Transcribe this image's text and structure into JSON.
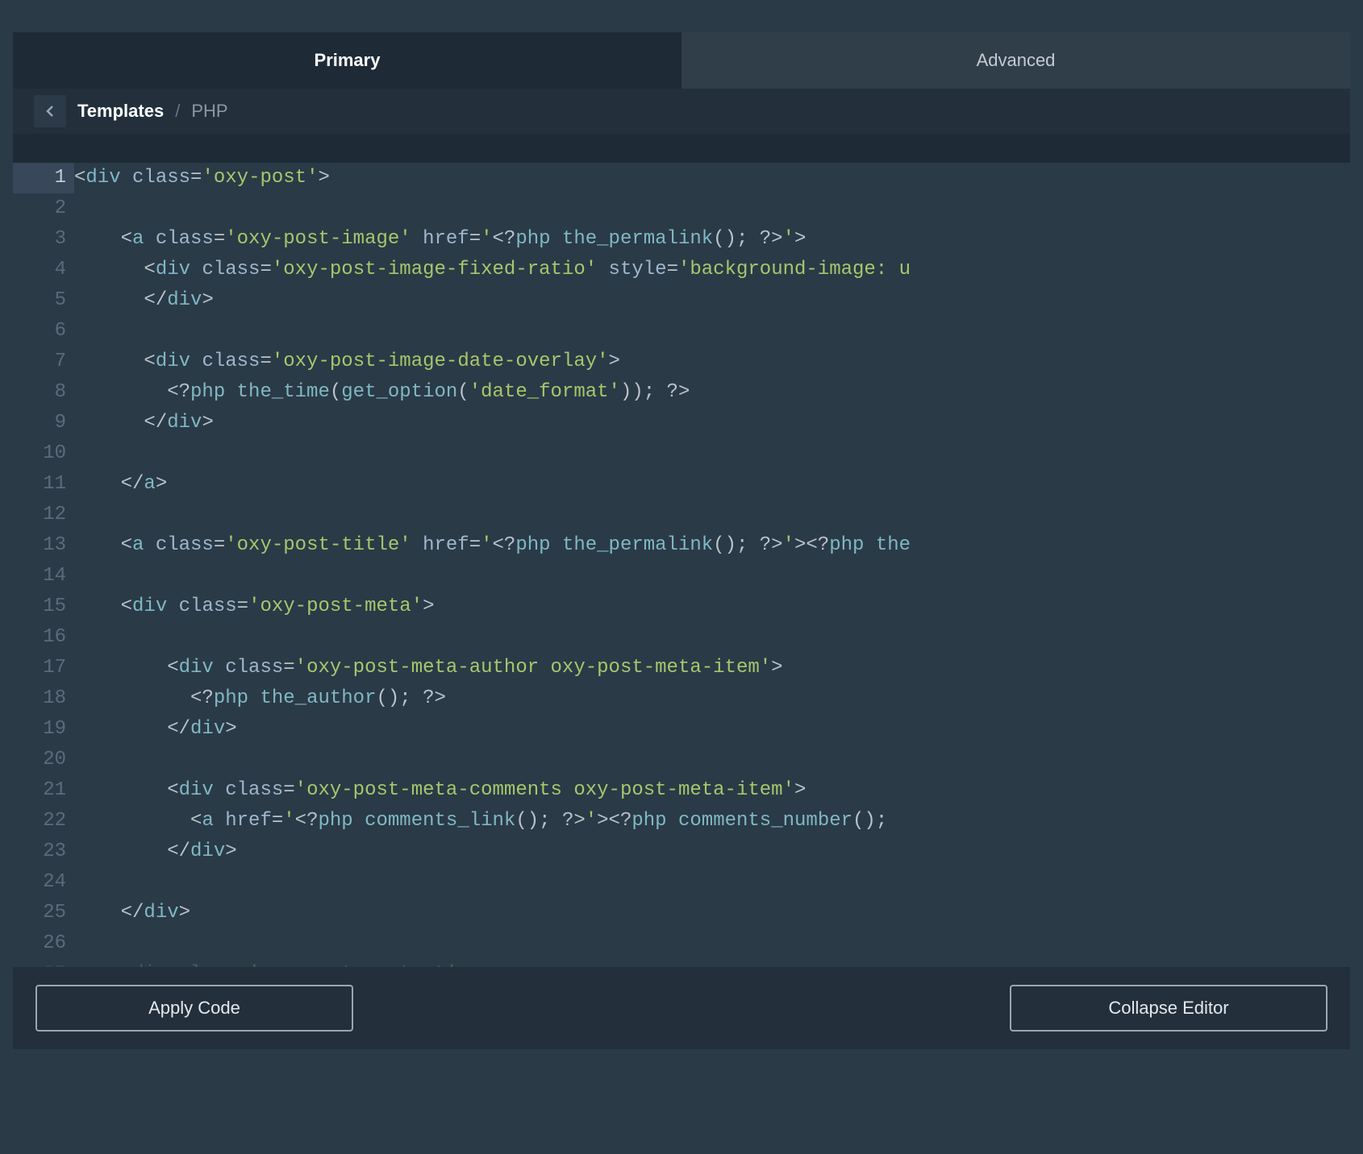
{
  "tabs": {
    "primary": "Primary",
    "advanced": "Advanced"
  },
  "breadcrumbs": {
    "root": "Templates",
    "sep": "/",
    "current": "PHP"
  },
  "footer": {
    "apply": "Apply Code",
    "collapse": "Collapse Editor"
  },
  "code": {
    "lines": [
      [
        {
          "c": "tok-punct",
          "t": "<"
        },
        {
          "c": "tok-tag",
          "t": "div"
        },
        {
          "c": "tok-attr",
          "t": " class"
        },
        {
          "c": "tok-punct",
          "t": "="
        },
        {
          "c": "tok-string",
          "t": "'oxy-post'"
        },
        {
          "c": "tok-punct",
          "t": ">"
        }
      ],
      [],
      [
        {
          "c": "",
          "t": "    "
        },
        {
          "c": "tok-punct",
          "t": "<"
        },
        {
          "c": "tok-tag",
          "t": "a"
        },
        {
          "c": "tok-attr",
          "t": " class"
        },
        {
          "c": "tok-punct",
          "t": "="
        },
        {
          "c": "tok-string",
          "t": "'oxy-post-image'"
        },
        {
          "c": "tok-attr",
          "t": " href"
        },
        {
          "c": "tok-punct",
          "t": "="
        },
        {
          "c": "tok-string",
          "t": "'"
        },
        {
          "c": "tok-punct",
          "t": "<?"
        },
        {
          "c": "tok-tag",
          "t": "php "
        },
        {
          "c": "tok-func",
          "t": "the_permalink"
        },
        {
          "c": "tok-punct",
          "t": "(); ?>"
        },
        {
          "c": "tok-string",
          "t": "'"
        },
        {
          "c": "tok-punct",
          "t": ">"
        }
      ],
      [
        {
          "c": "",
          "t": "      "
        },
        {
          "c": "tok-punct",
          "t": "<"
        },
        {
          "c": "tok-tag",
          "t": "div"
        },
        {
          "c": "tok-attr",
          "t": " class"
        },
        {
          "c": "tok-punct",
          "t": "="
        },
        {
          "c": "tok-string",
          "t": "'oxy-post-image-fixed-ratio'"
        },
        {
          "c": "tok-attr",
          "t": " style"
        },
        {
          "c": "tok-punct",
          "t": "="
        },
        {
          "c": "tok-string",
          "t": "'background-image: u"
        }
      ],
      [
        {
          "c": "",
          "t": "      "
        },
        {
          "c": "tok-punct",
          "t": "</"
        },
        {
          "c": "tok-tag",
          "t": "div"
        },
        {
          "c": "tok-punct",
          "t": ">"
        }
      ],
      [],
      [
        {
          "c": "",
          "t": "      "
        },
        {
          "c": "tok-punct",
          "t": "<"
        },
        {
          "c": "tok-tag",
          "t": "div"
        },
        {
          "c": "tok-attr",
          "t": " class"
        },
        {
          "c": "tok-punct",
          "t": "="
        },
        {
          "c": "tok-string",
          "t": "'oxy-post-image-date-overlay'"
        },
        {
          "c": "tok-punct",
          "t": ">"
        }
      ],
      [
        {
          "c": "",
          "t": "        "
        },
        {
          "c": "tok-punct",
          "t": "<?"
        },
        {
          "c": "tok-tag",
          "t": "php "
        },
        {
          "c": "tok-func",
          "t": "the_time"
        },
        {
          "c": "tok-punct",
          "t": "("
        },
        {
          "c": "tok-func",
          "t": "get_option"
        },
        {
          "c": "tok-punct",
          "t": "("
        },
        {
          "c": "tok-string",
          "t": "'date_format'"
        },
        {
          "c": "tok-punct",
          "t": ")); ?>"
        }
      ],
      [
        {
          "c": "",
          "t": "      "
        },
        {
          "c": "tok-punct",
          "t": "</"
        },
        {
          "c": "tok-tag",
          "t": "div"
        },
        {
          "c": "tok-punct",
          "t": ">"
        }
      ],
      [],
      [
        {
          "c": "",
          "t": "    "
        },
        {
          "c": "tok-punct",
          "t": "</"
        },
        {
          "c": "tok-tag",
          "t": "a"
        },
        {
          "c": "tok-punct",
          "t": ">"
        }
      ],
      [],
      [
        {
          "c": "",
          "t": "    "
        },
        {
          "c": "tok-punct",
          "t": "<"
        },
        {
          "c": "tok-tag",
          "t": "a"
        },
        {
          "c": "tok-attr",
          "t": " class"
        },
        {
          "c": "tok-punct",
          "t": "="
        },
        {
          "c": "tok-string",
          "t": "'oxy-post-title'"
        },
        {
          "c": "tok-attr",
          "t": " href"
        },
        {
          "c": "tok-punct",
          "t": "="
        },
        {
          "c": "tok-string",
          "t": "'"
        },
        {
          "c": "tok-punct",
          "t": "<?"
        },
        {
          "c": "tok-tag",
          "t": "php "
        },
        {
          "c": "tok-func",
          "t": "the_permalink"
        },
        {
          "c": "tok-punct",
          "t": "(); ?>"
        },
        {
          "c": "tok-string",
          "t": "'"
        },
        {
          "c": "tok-punct",
          "t": "><?"
        },
        {
          "c": "tok-tag",
          "t": "php "
        },
        {
          "c": "tok-func",
          "t": "the"
        }
      ],
      [],
      [
        {
          "c": "",
          "t": "    "
        },
        {
          "c": "tok-punct",
          "t": "<"
        },
        {
          "c": "tok-tag",
          "t": "div"
        },
        {
          "c": "tok-attr",
          "t": " class"
        },
        {
          "c": "tok-punct",
          "t": "="
        },
        {
          "c": "tok-string",
          "t": "'oxy-post-meta'"
        },
        {
          "c": "tok-punct",
          "t": ">"
        }
      ],
      [],
      [
        {
          "c": "",
          "t": "        "
        },
        {
          "c": "tok-punct",
          "t": "<"
        },
        {
          "c": "tok-tag",
          "t": "div"
        },
        {
          "c": "tok-attr",
          "t": " class"
        },
        {
          "c": "tok-punct",
          "t": "="
        },
        {
          "c": "tok-string",
          "t": "'oxy-post-meta-author oxy-post-meta-item'"
        },
        {
          "c": "tok-punct",
          "t": ">"
        }
      ],
      [
        {
          "c": "",
          "t": "          "
        },
        {
          "c": "tok-punct",
          "t": "<?"
        },
        {
          "c": "tok-tag",
          "t": "php "
        },
        {
          "c": "tok-func",
          "t": "the_author"
        },
        {
          "c": "tok-punct",
          "t": "(); ?>"
        }
      ],
      [
        {
          "c": "",
          "t": "        "
        },
        {
          "c": "tok-punct",
          "t": "</"
        },
        {
          "c": "tok-tag",
          "t": "div"
        },
        {
          "c": "tok-punct",
          "t": ">"
        }
      ],
      [],
      [
        {
          "c": "",
          "t": "        "
        },
        {
          "c": "tok-punct",
          "t": "<"
        },
        {
          "c": "tok-tag",
          "t": "div"
        },
        {
          "c": "tok-attr",
          "t": " class"
        },
        {
          "c": "tok-punct",
          "t": "="
        },
        {
          "c": "tok-string",
          "t": "'oxy-post-meta-comments oxy-post-meta-item'"
        },
        {
          "c": "tok-punct",
          "t": ">"
        }
      ],
      [
        {
          "c": "",
          "t": "          "
        },
        {
          "c": "tok-punct",
          "t": "<"
        },
        {
          "c": "tok-tag",
          "t": "a"
        },
        {
          "c": "tok-attr",
          "t": " href"
        },
        {
          "c": "tok-punct",
          "t": "="
        },
        {
          "c": "tok-string",
          "t": "'"
        },
        {
          "c": "tok-punct",
          "t": "<?"
        },
        {
          "c": "tok-tag",
          "t": "php "
        },
        {
          "c": "tok-func",
          "t": "comments_link"
        },
        {
          "c": "tok-punct",
          "t": "(); ?>"
        },
        {
          "c": "tok-string",
          "t": "'"
        },
        {
          "c": "tok-punct",
          "t": "><?"
        },
        {
          "c": "tok-tag",
          "t": "php "
        },
        {
          "c": "tok-func",
          "t": "comments_number"
        },
        {
          "c": "tok-punct",
          "t": "();"
        }
      ],
      [
        {
          "c": "",
          "t": "        "
        },
        {
          "c": "tok-punct",
          "t": "</"
        },
        {
          "c": "tok-tag",
          "t": "div"
        },
        {
          "c": "tok-punct",
          "t": ">"
        }
      ],
      [],
      [
        {
          "c": "",
          "t": "    "
        },
        {
          "c": "tok-punct",
          "t": "</"
        },
        {
          "c": "tok-tag",
          "t": "div"
        },
        {
          "c": "tok-punct",
          "t": ">"
        }
      ],
      [],
      [
        {
          "c": "",
          "t": "    "
        },
        {
          "c": "tok-punct",
          "t": "<"
        },
        {
          "c": "tok-tag",
          "t": "div"
        },
        {
          "c": "tok-attr",
          "t": " class"
        },
        {
          "c": "tok-punct",
          "t": "="
        },
        {
          "c": "tok-string",
          "t": "'oxy-post-content'"
        },
        {
          "c": "tok-punct",
          "t": ">"
        }
      ]
    ],
    "last_line_truncated_index": 26
  }
}
